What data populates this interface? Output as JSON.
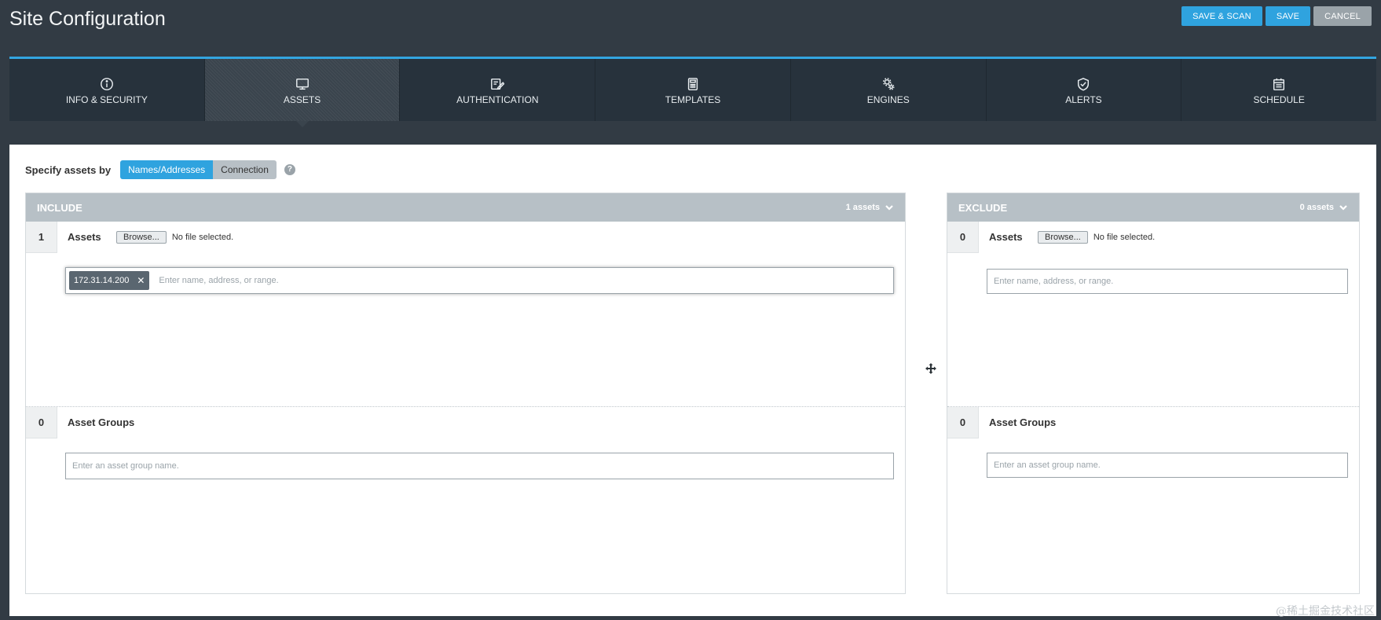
{
  "page": {
    "title": "Site Configuration",
    "actions": {
      "save_scan": "SAVE & SCAN",
      "save": "SAVE",
      "cancel": "CANCEL"
    }
  },
  "tabs": [
    {
      "label": "INFO & SECURITY",
      "icon": "info-icon",
      "active": false
    },
    {
      "label": "ASSETS",
      "icon": "monitor-icon",
      "active": true
    },
    {
      "label": "AUTHENTICATION",
      "icon": "edit-icon",
      "active": false
    },
    {
      "label": "TEMPLATES",
      "icon": "calculator-icon",
      "active": false
    },
    {
      "label": "ENGINES",
      "icon": "gears-icon",
      "active": false
    },
    {
      "label": "ALERTS",
      "icon": "shield-check-icon",
      "active": false
    },
    {
      "label": "SCHEDULE",
      "icon": "calendar-icon",
      "active": false
    }
  ],
  "specify": {
    "label": "Specify assets by",
    "options": [
      "Names/Addresses",
      "Connection"
    ],
    "selected": "Names/Addresses",
    "help": "?"
  },
  "include": {
    "title": "INCLUDE",
    "count": "1 assets",
    "assets": {
      "num": "1",
      "label": "Assets",
      "browse": "Browse...",
      "file_status": "No file selected.",
      "chips": [
        "172.31.14.200"
      ],
      "placeholder": "Enter name, address, or range."
    },
    "groups": {
      "num": "0",
      "label": "Asset Groups",
      "placeholder": "Enter an asset group name."
    }
  },
  "exclude": {
    "title": "EXCLUDE",
    "count": "0 assets",
    "assets": {
      "num": "0",
      "label": "Assets",
      "browse": "Browse...",
      "file_status": "No file selected.",
      "placeholder": "Enter name, address, or range."
    },
    "groups": {
      "num": "0",
      "label": "Asset Groups",
      "placeholder": "Enter an asset group name."
    }
  },
  "watermark": "@稀土掘金技术社区",
  "colors": {
    "accent": "#2fa3df",
    "header_bg": "#323b44",
    "tab_bg": "#27323c",
    "panel_header": "#b7c0c6"
  }
}
